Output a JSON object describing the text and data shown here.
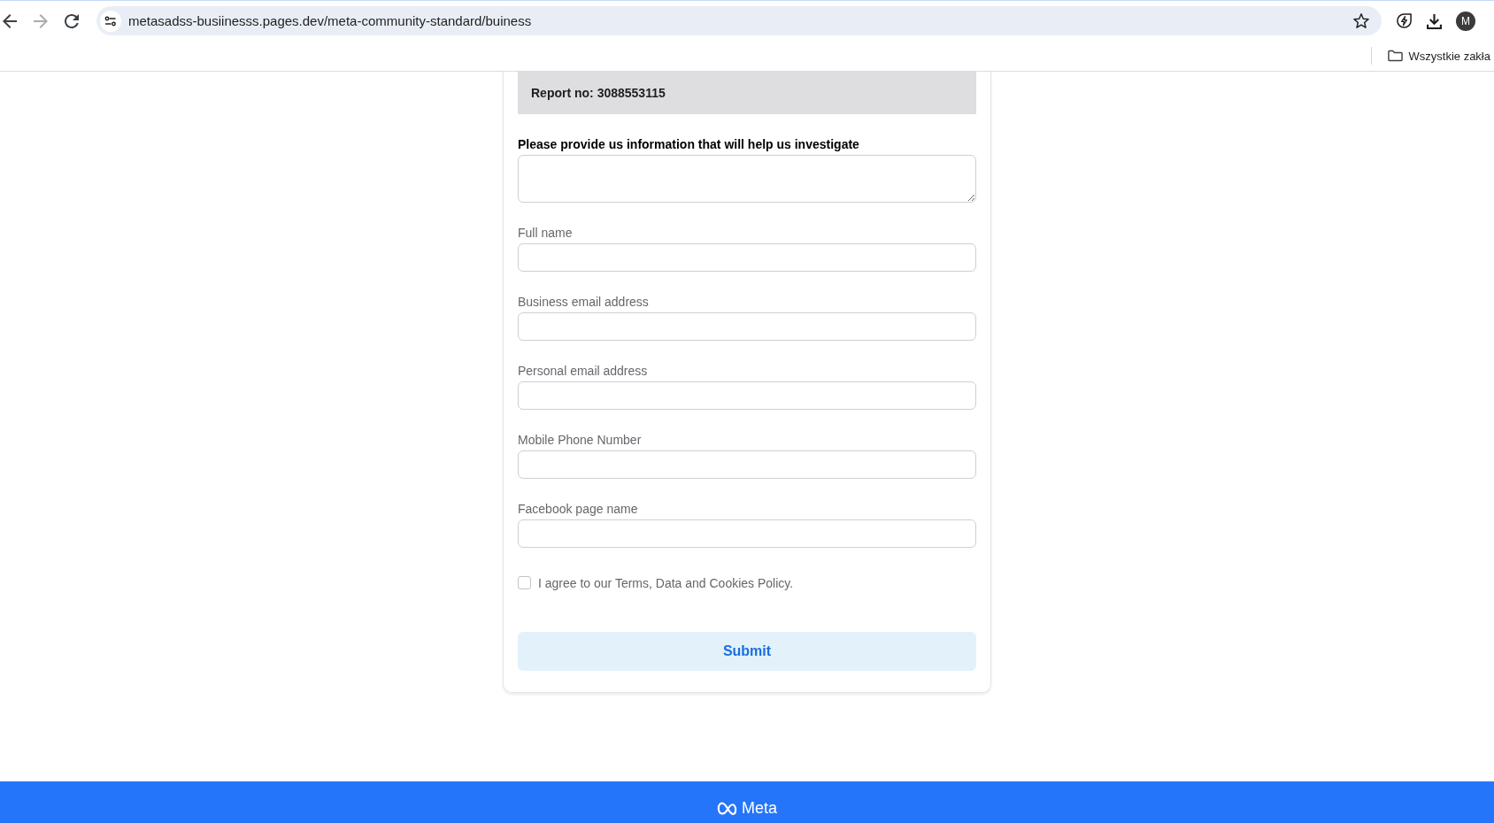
{
  "browser": {
    "nav": [
      {
        "kind": "back",
        "disabled": false
      },
      {
        "kind": "forward",
        "disabled": true
      },
      {
        "kind": "reload",
        "disabled": false
      }
    ],
    "url": "metasadss-busiinesss.pages.dev/meta-community-standard/buiness",
    "bookmarked": false,
    "profile_initial": "M",
    "bookmarks_folder": "Wszystkie zakła"
  },
  "form": {
    "report": "Report no: 3088553115",
    "fields": [
      {
        "kind": "textarea",
        "label": "Please provide us information that will help us investigate"
      },
      {
        "kind": "text",
        "label": "Full name"
      },
      {
        "kind": "text",
        "label": "Business email address"
      },
      {
        "kind": "text",
        "label": "Personal email address"
      },
      {
        "kind": "text",
        "label": "Mobile Phone Number"
      },
      {
        "kind": "text",
        "label": "Facebook page name"
      }
    ],
    "agreement": {
      "label": "I agree to our Terms, Data and Cookies Policy.",
      "checked": false
    },
    "submit": "Submit"
  },
  "footer": {
    "logo": "Meta"
  }
}
